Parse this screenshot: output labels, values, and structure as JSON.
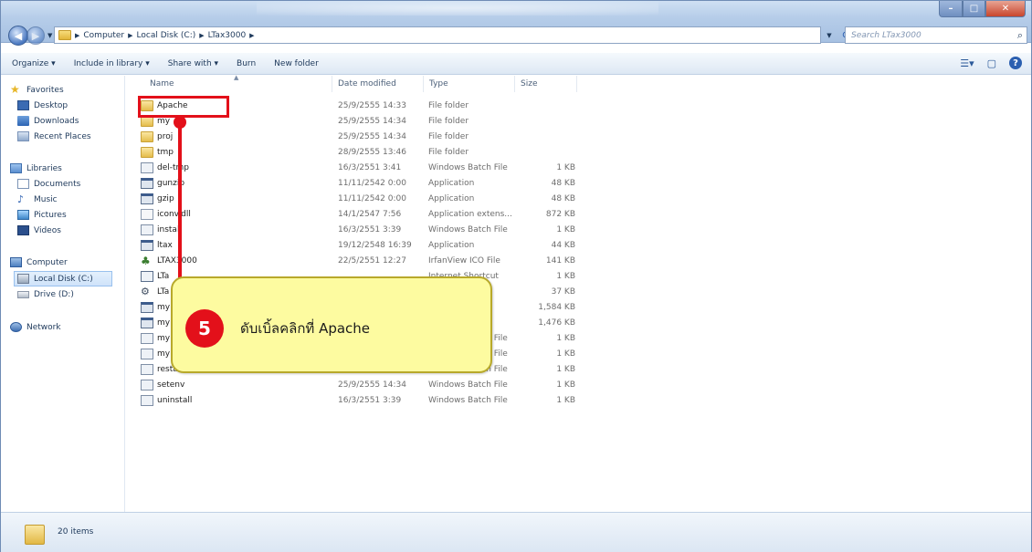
{
  "address": {
    "crumbs": [
      "Computer",
      "Local Disk (C:)",
      "LTax3000"
    ],
    "search_placeholder": "Search LTax3000"
  },
  "toolbar": {
    "organize": "Organize ▾",
    "include_in_library": "Include in library ▾",
    "share_with": "Share with ▾",
    "burn": "Burn",
    "new_folder": "New folder"
  },
  "navpane": {
    "favorites": "Favorites",
    "desktop": "Desktop",
    "downloads": "Downloads",
    "recent_places": "Recent Places",
    "libraries": "Libraries",
    "documents": "Documents",
    "music": "Music",
    "pictures": "Pictures",
    "videos": "Videos",
    "computer": "Computer",
    "local_disk": "Local Disk (C:)",
    "drive_d": "Drive (D:)",
    "network": "Network"
  },
  "columns": {
    "name": "Name",
    "date": "Date modified",
    "type": "Type",
    "size": "Size"
  },
  "files": [
    {
      "name": "Apache",
      "date": "25/9/2555 14:33",
      "type": "File folder",
      "size": "",
      "icon": "folder-icon"
    },
    {
      "name": "my",
      "date": "25/9/2555 14:34",
      "type": "File folder",
      "size": "",
      "icon": "folder-icon"
    },
    {
      "name": "proj",
      "date": "25/9/2555 14:34",
      "type": "File folder",
      "size": "",
      "icon": "folder-icon"
    },
    {
      "name": "tmp",
      "date": "28/9/2555 13:46",
      "type": "File folder",
      "size": "",
      "icon": "folder-icon"
    },
    {
      "name": "del-tmp",
      "date": "16/3/2551 3:41",
      "type": "Windows Batch File",
      "size": "1 KB",
      "icon": "batch-file-icon"
    },
    {
      "name": "gunzip",
      "date": "11/11/2542 0:00",
      "type": "Application",
      "size": "48 KB",
      "icon": "application-icon"
    },
    {
      "name": "gzip",
      "date": "11/11/2542 0:00",
      "type": "Application",
      "size": "48 KB",
      "icon": "application-icon"
    },
    {
      "name": "iconv.dll",
      "date": "14/1/2547 7:56",
      "type": "Application extens...",
      "size": "872 KB",
      "icon": "dll-file-icon"
    },
    {
      "name": "install",
      "date": "16/3/2551 3:39",
      "type": "Windows Batch File",
      "size": "1 KB",
      "icon": "batch-file-icon"
    },
    {
      "name": "ltax",
      "date": "19/12/2548 16:39",
      "type": "Application",
      "size": "44 KB",
      "icon": "application-icon"
    },
    {
      "name": "LTAX3000",
      "date": "22/5/2551 12:27",
      "type": "IrfanView ICO File",
      "size": "141 KB",
      "icon": "ico-file-icon"
    },
    {
      "name": "LTa",
      "date": "",
      "type": "Internet Shortcut",
      "size": "1 KB",
      "icon": "shortcut-icon"
    },
    {
      "name": "LTa",
      "date": "",
      "type": "",
      "size": "37 KB",
      "icon": "config-file-icon"
    },
    {
      "name": "my",
      "date": "",
      "type": "",
      "size": "1,584 KB",
      "icon": "application-icon"
    },
    {
      "name": "my",
      "date": "",
      "type": "",
      "size": "1,476 KB",
      "icon": "application-icon"
    },
    {
      "name": "my",
      "date": "",
      "type": "Windows Batch File",
      "size": "1 KB",
      "icon": "batch-file-icon"
    },
    {
      "name": "my",
      "date": "",
      "type": "Windows Batch File",
      "size": "1 KB",
      "icon": "batch-file-icon"
    },
    {
      "name": "restart",
      "date": "",
      "type": "Windows Batch File",
      "size": "1 KB",
      "icon": "batch-file-icon"
    },
    {
      "name": "setenv",
      "date": "25/9/2555 14:34",
      "type": "Windows Batch File",
      "size": "1 KB",
      "icon": "batch-file-icon"
    },
    {
      "name": "uninstall",
      "date": "16/3/2551 3:39",
      "type": "Windows Batch File",
      "size": "1 KB",
      "icon": "batch-file-icon"
    }
  ],
  "status": {
    "item_count": "20 items"
  },
  "callout": {
    "step_number": "5",
    "instruction": "ดับเบิ้ลคลิกที่  Apache"
  },
  "colors": {
    "accent_red": "#e3101a",
    "callout_yellow": "#fdfba0"
  }
}
